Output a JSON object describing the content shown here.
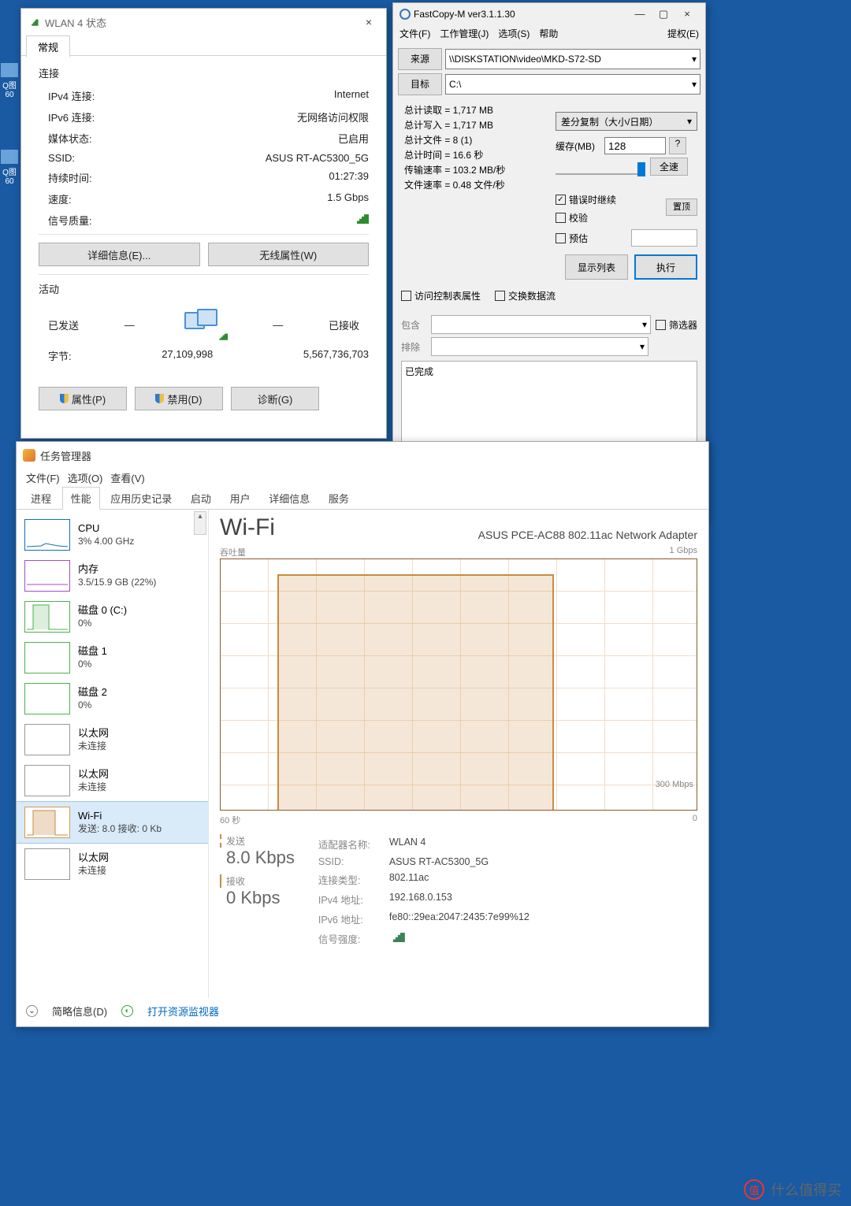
{
  "desktop": {
    "icon1": "Q图\n60",
    "icon2": "Q图\n60"
  },
  "wlan": {
    "title": "WLAN 4 状态",
    "close": "×",
    "tab": "常规",
    "sec_conn": "连接",
    "rows": {
      "ipv4_k": "IPv4 连接:",
      "ipv4_v": "Internet",
      "ipv6_k": "IPv6 连接:",
      "ipv6_v": "无网络访问权限",
      "media_k": "媒体状态:",
      "media_v": "已启用",
      "ssid_k": "SSID:",
      "ssid_v": "ASUS RT-AC5300_5G",
      "dur_k": "持续时间:",
      "dur_v": "01:27:39",
      "speed_k": "速度:",
      "speed_v": "1.5 Gbps",
      "sig_k": "信号质量:"
    },
    "btn_detail": "详细信息(E)...",
    "btn_wprops": "无线属性(W)",
    "sec_act": "活动",
    "sent": "已发送",
    "recv": "已接收",
    "bytes_k": "字节:",
    "bytes_sent": "27,109,998",
    "bytes_recv": "5,567,736,703",
    "btn_props": "属性(P)",
    "btn_disable": "禁用(D)",
    "btn_diag": "诊断(G)"
  },
  "fastcopy": {
    "title": "FastCopy-M ver3.1.1.30",
    "menu": {
      "file": "文件(F)",
      "work": "工作管理(J)",
      "opt": "选项(S)",
      "help": "帮助",
      "ext": "提权(E)"
    },
    "src_btn": "来源",
    "src_val": "\\\\DISKSTATION\\video\\MKD-S72-SD",
    "dst_btn": "目标",
    "dst_val": "C:\\",
    "stats": {
      "read": "总计读取 = 1,717 MB",
      "write": "总计写入 = 1,717 MB",
      "files": "总计文件 = 8 (1)",
      "time": "总计时间 = 16.6 秒",
      "rate": "传输速率 = 103.2 MB/秒",
      "frate": "文件速率 = 0.48 文件/秒"
    },
    "mode": "差分复制（大小/日期）",
    "cache_lbl": "缓存(MB)",
    "cache_val": "128",
    "q": "?",
    "fullspeed": "全速",
    "pin": "置顶",
    "chk_err": "错误时继续",
    "chk_verify": "校验",
    "chk_est": "预估",
    "btn_list": "显示列表",
    "btn_exec": "执行",
    "chk_acl": "访问控制表属性",
    "chk_stream": "交换数据流",
    "inc": "包含",
    "exc": "排除",
    "filter": "筛选器",
    "log": "已完成"
  },
  "taskmgr": {
    "title": "任务管理器",
    "menu": {
      "file": "文件(F)",
      "opt": "选项(O)",
      "view": "查看(V)"
    },
    "tabs": {
      "proc": "进程",
      "perf": "性能",
      "hist": "应用历史记录",
      "startup": "启动",
      "users": "用户",
      "details": "详细信息",
      "svc": "服务"
    },
    "side": {
      "cpu_n": "CPU",
      "cpu_s": "3%  4.00 GHz",
      "mem_n": "内存",
      "mem_s": "3.5/15.9 GB (22%)",
      "disk0_n": "磁盘 0 (C:)",
      "disk0_s": "0%",
      "disk1_n": "磁盘 1",
      "disk1_s": "0%",
      "disk2_n": "磁盘 2",
      "disk2_s": "0%",
      "eth1_n": "以太网",
      "eth1_s": "未连接",
      "eth2_n": "以太网",
      "eth2_s": "未连接",
      "wifi_n": "Wi-Fi",
      "wifi_s": "发送: 8.0  接收: 0 Kb",
      "eth3_n": "以太网",
      "eth3_s": "未连接"
    },
    "main": {
      "h1": "Wi-Fi",
      "h2": "ASUS PCE-AC88 802.11ac Network Adapter",
      "throughput": "吞吐量",
      "ymax": "1 Gbps",
      "ymark": "300 Mbps",
      "xleft": "60 秒",
      "xright": "0",
      "send_lbl": "发送",
      "send_val": "8.0 Kbps",
      "recv_lbl": "接收",
      "recv_val": "0 Kbps",
      "adapter_k": "适配器名称:",
      "adapter_v": "WLAN 4",
      "ssid_k": "SSID:",
      "ssid_v": "ASUS RT-AC5300_5G",
      "conn_k": "连接类型:",
      "conn_v": "802.11ac",
      "ipv4_k": "IPv4 地址:",
      "ipv4_v": "192.168.0.153",
      "ipv6_k": "IPv6 地址:",
      "ipv6_v": "fe80::29ea:2047:2435:7e99%12",
      "sig_k": "信号强度:"
    },
    "foot": {
      "brief": "简略信息(D)",
      "monitor": "打开资源监视器"
    }
  },
  "watermark": "什么值得买"
}
